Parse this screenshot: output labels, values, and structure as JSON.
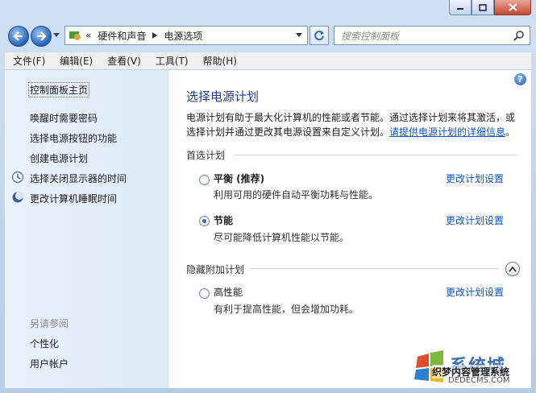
{
  "window": {
    "caption_buttons": [
      "minimize",
      "maximize",
      "close"
    ]
  },
  "nav": {
    "breadcrumb": [
      "硬件和声音",
      "电源选项"
    ],
    "breadcrumb_prefix": "«",
    "search_placeholder": "搜索控制面板"
  },
  "menu": [
    "文件(F)",
    "编辑(E)",
    "查看(V)",
    "工具(T)",
    "帮助(H)"
  ],
  "sidebar": {
    "home": "控制面板主页",
    "links": [
      "唤醒时需要密码",
      "选择电源按钮的功能",
      "创建电源计划",
      "选择关闭显示器的时间",
      "更改计算机睡眠时间"
    ],
    "see_also_title": "另请参阅",
    "see_also": [
      "个性化",
      "用户帐户"
    ]
  },
  "main": {
    "title": "选择电源计划",
    "desc_line1": "电源计划有助于最大化计算机的性能或者节能。通过选择计划来将其激活，或",
    "desc_line2": "选择计划并通过更改其电源设置来自定义计划。",
    "desc_link": "请提供电源计划的详细信息",
    "desc_end": "。",
    "preferred_title": "首选计划",
    "hidden_title": "隐藏附加计划",
    "change_label": "更改计划设置",
    "plans": [
      {
        "name": "平衡 (推荐)",
        "desc": "利用可用的硬件自动平衡功耗与性能。",
        "selected": false
      },
      {
        "name": "节能",
        "desc": "尽可能降低计算机性能以节能。",
        "selected": true
      }
    ],
    "hidden_plans": [
      {
        "name": "高性能",
        "desc": "有利于提高性能，但会增加功耗。",
        "selected": false
      }
    ]
  },
  "watermark": {
    "logo_text": "系统城",
    "brand": "织梦内容管理系统",
    "url": "DEDECMS.COM"
  }
}
